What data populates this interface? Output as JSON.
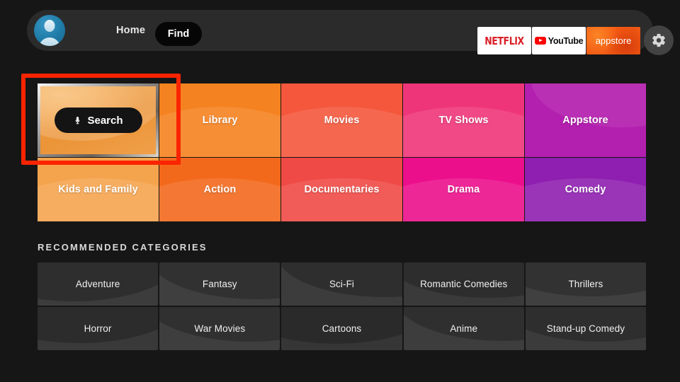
{
  "header": {
    "avatar": "user-avatar",
    "nav": [
      {
        "label": "Home",
        "selected": false
      },
      {
        "label": "Find",
        "selected": true
      }
    ],
    "apps": [
      {
        "name": "netflix",
        "label": "NETFLIX"
      },
      {
        "name": "youtube",
        "label": "YouTube"
      },
      {
        "name": "appstore",
        "label": "appstore"
      }
    ],
    "settings_icon": "gear-icon"
  },
  "tiles": {
    "search": {
      "button_label": "Search",
      "mic_icon": "microphone-icon",
      "highlighted": true,
      "highlight_color": "#fa2400",
      "bg_color": "#f1a04b"
    },
    "items": [
      {
        "label": "Library",
        "color": "#f58220"
      },
      {
        "label": "Movies",
        "color": "#f4573c"
      },
      {
        "label": "TV Shows",
        "color": "#ef3579"
      },
      {
        "label": "Appstore",
        "color": "#b31fae"
      },
      {
        "label": "Kids and Family",
        "color": "#f5a44e"
      },
      {
        "label": "Action",
        "color": "#f3691c"
      },
      {
        "label": "Documentaries",
        "color": "#f04a46"
      },
      {
        "label": "Drama",
        "color": "#ec0f8c"
      },
      {
        "label": "Comedy",
        "color": "#8f1fb0"
      }
    ]
  },
  "recommended": {
    "title": "RECOMMENDED CATEGORIES",
    "items": [
      {
        "label": "Adventure"
      },
      {
        "label": "Fantasy"
      },
      {
        "label": "Sci-Fi"
      },
      {
        "label": "Romantic Comedies"
      },
      {
        "label": "Thrillers"
      },
      {
        "label": "Horror"
      },
      {
        "label": "War Movies"
      },
      {
        "label": "Cartoons"
      },
      {
        "label": "Anime"
      },
      {
        "label": "Stand-up Comedy"
      }
    ]
  },
  "colors": {
    "background": "#161616",
    "header_bar": "#2b2b2b",
    "rec_tile": "#3c3c3c",
    "accent_highlight": "#fa2400"
  }
}
